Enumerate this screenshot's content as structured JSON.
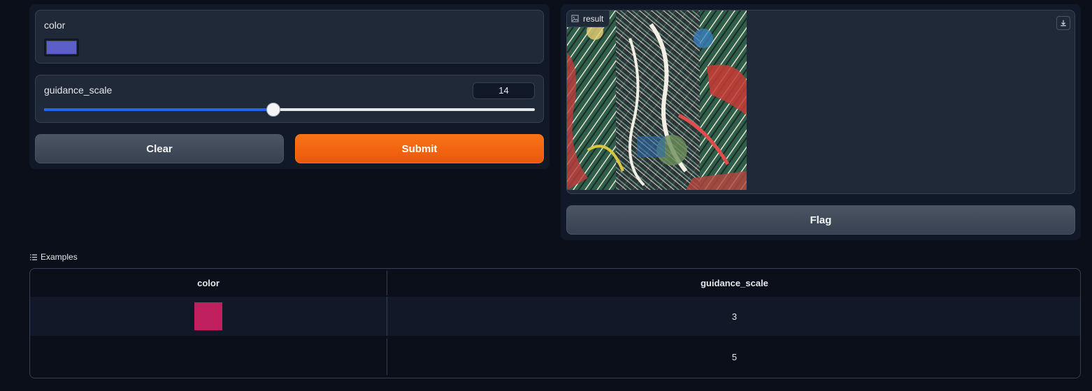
{
  "inputs": {
    "color": {
      "label": "color",
      "value": "#5b5fc7"
    },
    "guidance_scale": {
      "label": "guidance_scale",
      "value": "14",
      "min": 0,
      "max": 30,
      "accent": "#2563eb"
    }
  },
  "buttons": {
    "clear": "Clear",
    "submit": "Submit",
    "flag": "Flag"
  },
  "output": {
    "label": "result",
    "icons": {
      "label_icon": "image-icon",
      "download": "download-icon"
    }
  },
  "examples": {
    "title": "Examples",
    "icon": "list-icon",
    "headers": [
      "color",
      "guidance_scale"
    ],
    "rows": [
      {
        "color": "#c0215e",
        "guidance_scale": "3"
      },
      {
        "color": "",
        "guidance_scale": "5"
      }
    ]
  }
}
